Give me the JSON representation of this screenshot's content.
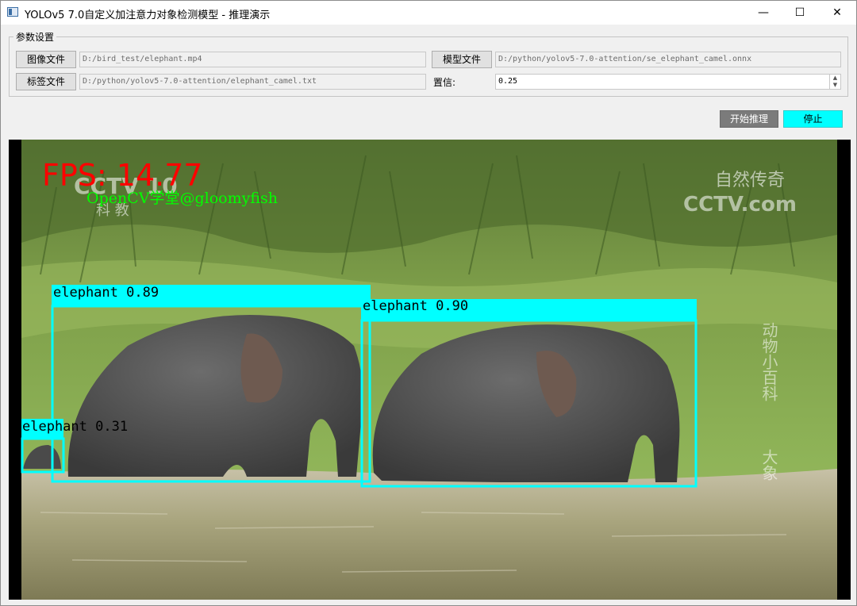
{
  "window": {
    "title": "YOLOv5 7.0自定义加注意力对象检测模型 - 推理演示",
    "minimize_glyph": "—",
    "maximize_glyph": "☐",
    "close_glyph": "✕"
  },
  "params": {
    "group_title": "参数设置",
    "image_file_button": "图像文件",
    "image_file_value": "D:/bird_test/elephant.mp4",
    "label_file_button": "标签文件",
    "label_file_value": "D:/python/yolov5-7.0-attention/elephant_camel.txt",
    "model_file_button": "模型文件",
    "model_file_value": "D:/python/yolov5-7.0-attention/se_elephant_camel.onnx",
    "confidence_label": "置信:",
    "confidence_value": "0.25"
  },
  "actions": {
    "start_label": "开始推理",
    "stop_label": "停止",
    "start_color": "#7b7b7b",
    "stop_color": "#00ffff"
  },
  "video": {
    "fps_text": "FPS: 14.77",
    "fps_color": "#ff0000",
    "watermark_text": "OpenCV学堂@gloomyfish",
    "watermark_color": "#00ff00",
    "channel_logo_left_line1": "CCTV 10",
    "channel_logo_left_line2": "科 教",
    "channel_logo_right_line1": "自然传奇",
    "channel_logo_right_line2": "CCTV.com",
    "vertical_caption": "动物小百科",
    "vertical_caption_2": "大象",
    "box_color": "#00ffff",
    "detections": [
      {
        "label": "elephant 0.89"
      },
      {
        "label": "elephant 0.90"
      },
      {
        "label": "elephant 0.31"
      }
    ]
  }
}
